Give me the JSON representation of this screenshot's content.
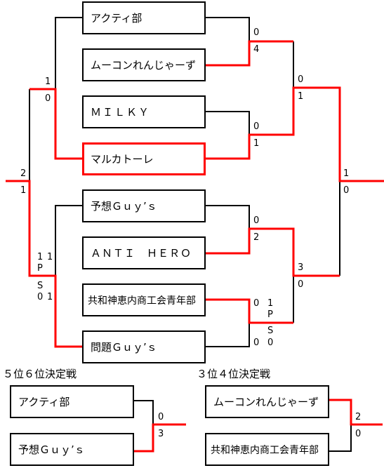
{
  "main_bracket": {
    "teams": [
      "アクティ部",
      "ムーコンれんじゃーず",
      "ＭＩＬＫＹ",
      "マルカトーレ",
      "予想Ｇｕｙ’ｓ",
      "ＡＮＴＩ　ＨＥＲＯ",
      "共和神恵内商工会青年部",
      "問題Ｇｕｙ’ｓ"
    ],
    "scores": {
      "r1_m1": [
        "0",
        "4"
      ],
      "r1_m2": [
        "0",
        "1"
      ],
      "r1_m3": [
        "0",
        "2"
      ],
      "r1_m4": [
        "0",
        "1",
        "P",
        "S",
        "0",
        "0"
      ],
      "sf_right_top": [
        "0",
        "1"
      ],
      "sf_right_bottom": [
        "3",
        "0"
      ],
      "final_right": [
        "1",
        "0"
      ],
      "left_top": [
        "1",
        "0"
      ],
      "left_bottom": [
        "1",
        "1",
        "P",
        "S",
        "0",
        "1"
      ],
      "left_final": [
        "2",
        "1"
      ]
    }
  },
  "fifth_place": {
    "title": "５位６位決定戦",
    "teams": [
      "アクティ部",
      "予想Ｇｕｙ’ｓ"
    ],
    "scores": [
      "0",
      "3"
    ]
  },
  "third_place": {
    "title": "３位４位決定戦",
    "teams": [
      "ムーコンれんじゃーず",
      "共和神恵内商工会青年部"
    ],
    "scores": [
      "2",
      "0"
    ]
  },
  "colors": {
    "winner_line": "#ff0000",
    "line": "#000000"
  }
}
